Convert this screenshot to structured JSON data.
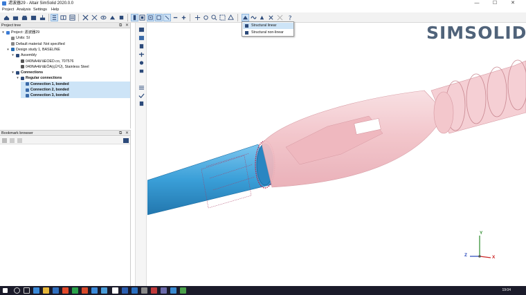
{
  "window": {
    "title": "滤波器29 - Altair SimSolid 2020.0.0",
    "minimize": "—",
    "maximize": "☐",
    "close": "✕"
  },
  "menu": [
    "Project",
    "Analysis",
    "Settings",
    "Help"
  ],
  "toolbar": {
    "icons": [
      "new-project-icon",
      "open-project-icon",
      "save-icon",
      "save-as-icon",
      "import-icon",
      "tree-view-icon",
      "split-icon",
      "connections-icon",
      "visibility-icon",
      "section-icon",
      "measure-icon",
      "materials-icon",
      "color-icon",
      "select-icon",
      "select-all-icon",
      "select-box-icon",
      "select-face-icon",
      "analysis-icon",
      "modal-icon",
      "thermal-icon",
      "fatigue-icon",
      "options-icon",
      "help-icon"
    ]
  },
  "project_tree": {
    "header": "Project tree",
    "items": [
      {
        "text": "Project: 滤波器29",
        "level": 0,
        "icon": "project-icon",
        "selected": false
      },
      {
        "text": "Units: SI",
        "level": 1,
        "icon": "units-icon",
        "selected": false
      },
      {
        "text": "Default material: Not specified",
        "level": 1,
        "icon": "material-icon",
        "selected": false
      },
      {
        "text": "Design study 1, BASELINE",
        "level": 1,
        "icon": "design-study-icon",
        "selected": false
      },
      {
        "text": "Assembly",
        "level": 2,
        "icon": "assembly-icon",
        "selected": false
      },
      {
        "text": "040NA4â¹âEOED.co, 707576",
        "level": 3,
        "icon": "part-icon",
        "selected": false
      },
      {
        "text": "040NA4â¹âEÖA(çÜ¹Ú), Stainless Steel",
        "level": 3,
        "icon": "part-icon",
        "selected": false
      },
      {
        "text": "Connections",
        "level": 2,
        "icon": "connections-icon",
        "selected": false
      },
      {
        "text": "Regular connections",
        "level": 3,
        "icon": "connection-group-icon",
        "selected": false
      },
      {
        "text": "Connection 1, bonded",
        "level": 4,
        "icon": "bonded-icon",
        "selected": true
      },
      {
        "text": "Connection 2, bonded",
        "level": 4,
        "icon": "bonded-icon",
        "selected": true
      },
      {
        "text": "Connection 3, bonded",
        "level": 4,
        "icon": "bonded-icon",
        "selected": true
      }
    ]
  },
  "bookmark_browser": {
    "header": "Bookmark browser"
  },
  "dropdown": {
    "items": [
      {
        "label": "Structural linear",
        "highlighted": true
      },
      {
        "label": "Structural non-linear",
        "highlighted": false
      }
    ]
  },
  "logo": "SIMSOLID",
  "triad": {
    "y": "Y",
    "x": "X",
    "z": "Z"
  },
  "taskbar": {
    "clock": "19:04"
  },
  "colors": {
    "pipe_blue": "#3a9fd8",
    "body_pink": "#f3c7cc",
    "logo": "#50637a",
    "selection": "#cde4f7",
    "axis_y": "#2a8a2a",
    "axis_x": "#cc2222",
    "axis_z": "#2244bb"
  }
}
